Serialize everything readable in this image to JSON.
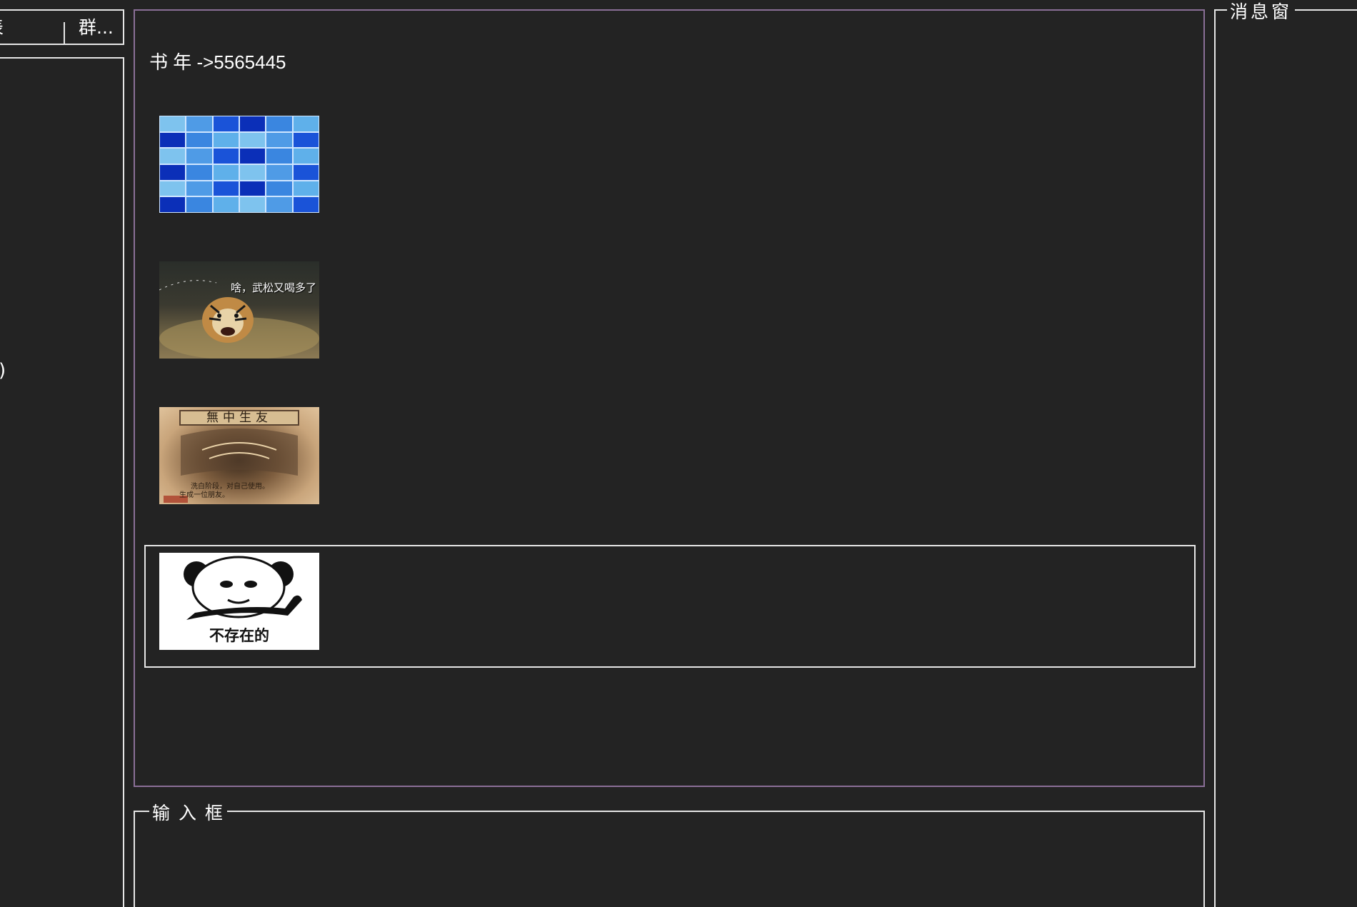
{
  "left_panel": {
    "tabs": [
      {
        "label": "表"
      },
      {
        "label": "群..."
      }
    ],
    "list_stub": ")"
  },
  "chat": {
    "sender_line": "书 年 ->5565445",
    "messages": [
      {
        "type": "image",
        "name": "blue-tiles-image"
      },
      {
        "type": "image",
        "name": "tiger-meme-image",
        "caption": "啥，武松又喝多了"
      },
      {
        "type": "image",
        "name": "parchment-card-image",
        "title": "無中生友",
        "line1": "洗白阶段，对自己使用。",
        "line2": "生成一位朋友。"
      },
      {
        "type": "image",
        "name": "panda-meme-image",
        "caption": "不存在的"
      }
    ]
  },
  "input_frame": {
    "label": "输 入 框"
  },
  "message_window": {
    "label": "消息窗"
  },
  "colors": {
    "background": "#232323",
    "chat_border": "#8a6f97",
    "frame_border": "#e6e6e6",
    "text": "#ffffff"
  }
}
